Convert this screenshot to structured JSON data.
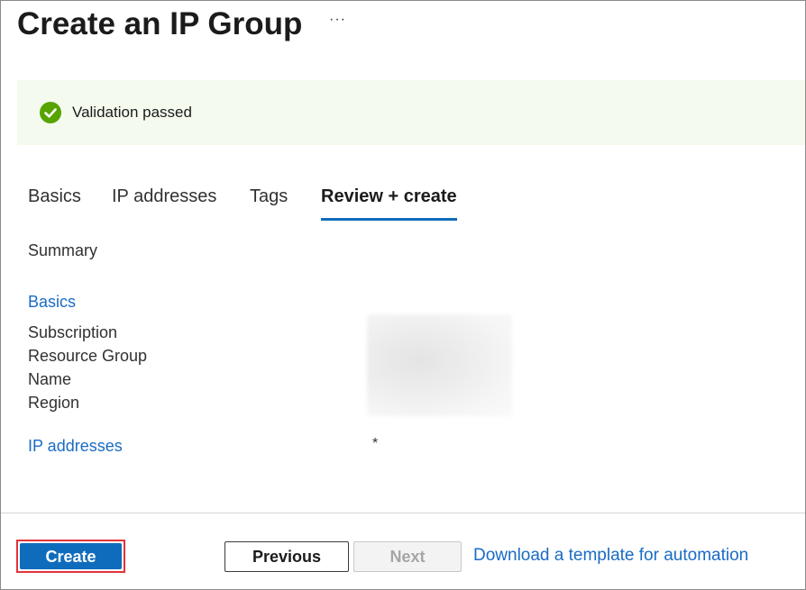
{
  "header": {
    "title": "Create an IP Group",
    "more_label": "···"
  },
  "banner": {
    "status_icon": "check-circle-icon",
    "message": "Validation passed",
    "color": "#57a300"
  },
  "tabs": [
    {
      "label": "Basics",
      "active": false
    },
    {
      "label": "IP addresses",
      "active": false
    },
    {
      "label": "Tags",
      "active": false
    },
    {
      "label": "Review + create",
      "active": true
    }
  ],
  "summary": {
    "heading": "Summary",
    "sections": {
      "basics": {
        "title": "Basics",
        "fields": [
          "Subscription",
          "Resource Group",
          "Name",
          "Region"
        ]
      },
      "ip_addresses": {
        "title": "IP addresses",
        "value": "*"
      }
    }
  },
  "footer": {
    "create_label": "Create",
    "previous_label": "Previous",
    "next_label": "Next",
    "download_label": "Download a template for automation"
  },
  "colors": {
    "accent": "#0f6cbd",
    "link": "#1a6bc4",
    "highlight_outline": "#e0353b"
  }
}
